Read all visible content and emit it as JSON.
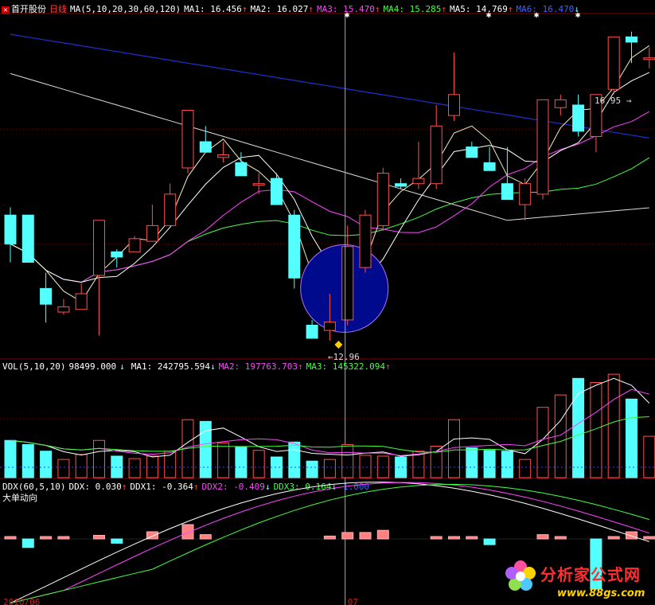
{
  "stock": {
    "name": "首开股份",
    "period": "日线"
  },
  "price_panel": {
    "indicator": "MA(5,10,20,30,60,120)",
    "items": [
      {
        "label": "MA1:",
        "value": "16.456",
        "arrow": "↑",
        "color": "#ffffff"
      },
      {
        "label": "MA2:",
        "value": "16.027",
        "arrow": "↑",
        "color": "#ffffff"
      },
      {
        "label": "MA3:",
        "value": "15.470",
        "arrow": "↑",
        "color": "#ff44ff"
      },
      {
        "label": "MA4:",
        "value": "15.285",
        "arrow": "↑",
        "color": "#44ff44"
      },
      {
        "label": "MA5:",
        "value": "14.769",
        "arrow": "↑",
        "color": "#ffffff"
      },
      {
        "label": "MA6:",
        "value": "16.470",
        "arrow": "↓",
        "color": "#4060ff"
      }
    ],
    "high_label": "16.95",
    "low_label": "12.96"
  },
  "vol_panel": {
    "indicator": "VOL(5,10,20)",
    "value": "98499.000",
    "arrow": "↓",
    "items": [
      {
        "label": "MA1:",
        "value": "242795.594",
        "arrow": "↓",
        "color": "#ffffff"
      },
      {
        "label": "MA2:",
        "value": "197763.703",
        "arrow": "↑",
        "color": "#ff44ff"
      },
      {
        "label": "MA3:",
        "value": "145322.094",
        "arrow": "↑",
        "color": "#44ff44"
      }
    ]
  },
  "ddx_panel": {
    "indicator": "DDX(60,5,10)",
    "items": [
      {
        "label": "DDX:",
        "value": "0.030",
        "arrow": "↑",
        "color": "#ffffff"
      },
      {
        "label": "DDX1:",
        "value": "-0.364",
        "arrow": "↑",
        "color": "#ffffff"
      },
      {
        "label": "DDX2:",
        "value": "-0.409",
        "arrow": "↓",
        "color": "#ff44ff"
      },
      {
        "label": "DDX3:",
        "value": "0.164",
        "arrow": "↓",
        "color": "#44ff44"
      }
    ],
    "ref_value": "1.000",
    "subtitle": "大单动向"
  },
  "watermark": {
    "brand": "分析家公式网",
    "url": "www.88gs.com"
  },
  "colors": {
    "up": "#ff5050",
    "down": "#54ffff",
    "grid": "#800000",
    "ma6": "#2030d0"
  },
  "chart_data": {
    "type": "candlestick",
    "candles": [
      {
        "o": 15.0,
        "h": 15.15,
        "l": 14.1,
        "c": 14.45
      },
      {
        "o": 15.0,
        "h": 15.0,
        "l": 14.2,
        "c": 14.1
      },
      {
        "o": 13.6,
        "h": 13.9,
        "l": 12.95,
        "c": 13.3
      },
      {
        "o": 13.15,
        "h": 13.4,
        "l": 13.1,
        "c": 13.25
      },
      {
        "o": 13.2,
        "h": 13.7,
        "l": 13.2,
        "c": 13.5
      },
      {
        "o": 13.85,
        "h": 14.8,
        "l": 12.7,
        "c": 14.9
      },
      {
        "o": 14.3,
        "h": 14.35,
        "l": 14.0,
        "c": 14.2
      },
      {
        "o": 14.3,
        "h": 14.6,
        "l": 14.3,
        "c": 14.55
      },
      {
        "o": 14.5,
        "h": 15.2,
        "l": 14.5,
        "c": 14.8
      },
      {
        "o": 14.8,
        "h": 15.6,
        "l": 14.8,
        "c": 15.4
      },
      {
        "o": 15.9,
        "h": 16.5,
        "l": 15.8,
        "c": 17.0
      },
      {
        "o": 16.4,
        "h": 16.7,
        "l": 16.3,
        "c": 16.2
      },
      {
        "o": 16.1,
        "h": 16.4,
        "l": 16.0,
        "c": 16.15
      },
      {
        "o": 16.0,
        "h": 16.2,
        "l": 15.8,
        "c": 15.75
      },
      {
        "o": 15.6,
        "h": 15.8,
        "l": 15.4,
        "c": 15.6
      },
      {
        "o": 15.7,
        "h": 15.8,
        "l": 15.2,
        "c": 15.2
      },
      {
        "o": 15.0,
        "h": 15.1,
        "l": 13.6,
        "c": 13.8
      },
      {
        "o": 12.9,
        "h": 13.0,
        "l": 12.7,
        "c": 12.65
      },
      {
        "o": 12.8,
        "h": 13.5,
        "l": 12.6,
        "c": 12.96
      },
      {
        "o": 13.0,
        "h": 14.8,
        "l": 12.9,
        "c": 14.4
      },
      {
        "o": 14.0,
        "h": 15.1,
        "l": 13.9,
        "c": 15.0
      },
      {
        "o": 14.8,
        "h": 15.9,
        "l": 14.7,
        "c": 15.8
      },
      {
        "o": 15.6,
        "h": 15.7,
        "l": 15.5,
        "c": 15.55
      },
      {
        "o": 15.6,
        "h": 16.4,
        "l": 15.5,
        "c": 15.7
      },
      {
        "o": 15.6,
        "h": 17.1,
        "l": 15.5,
        "c": 16.7
      },
      {
        "o": 16.9,
        "h": 18.1,
        "l": 16.8,
        "c": 17.3
      },
      {
        "o": 16.3,
        "h": 16.4,
        "l": 16.1,
        "c": 16.1
      },
      {
        "o": 16.0,
        "h": 16.3,
        "l": 15.9,
        "c": 15.85
      },
      {
        "o": 15.6,
        "h": 16.3,
        "l": 15.4,
        "c": 15.3
      },
      {
        "o": 15.2,
        "h": 15.7,
        "l": 14.9,
        "c": 15.6
      },
      {
        "o": 15.4,
        "h": 17.2,
        "l": 15.3,
        "c": 17.2
      },
      {
        "o": 17.05,
        "h": 17.3,
        "l": 16.9,
        "c": 17.2
      },
      {
        "o": 17.1,
        "h": 17.3,
        "l": 16.5,
        "c": 16.6
      },
      {
        "o": 16.5,
        "h": 17.0,
        "l": 16.2,
        "c": 17.3
      },
      {
        "o": 17.4,
        "h": 18.4,
        "l": 17.3,
        "c": 18.4
      },
      {
        "o": 18.4,
        "h": 18.5,
        "l": 17.9,
        "c": 18.3
      },
      {
        "o": 18.0,
        "h": 18.2,
        "l": 17.8,
        "c": 18.0
      }
    ],
    "volume": [
      45,
      40,
      32,
      22,
      28,
      45,
      26,
      23,
      26,
      32,
      70,
      68,
      42,
      37,
      33,
      25,
      43,
      20,
      22,
      40,
      27,
      26,
      25,
      32,
      38,
      70,
      36,
      33,
      32,
      22,
      85,
      100,
      120,
      115,
      125,
      95,
      50
    ],
    "ddx": [
      0.03,
      -0.12,
      0.02,
      0.01,
      0.0,
      0.05,
      -0.06,
      0.0,
      0.1,
      0.0,
      0.2,
      0.06,
      0.0,
      0.0,
      0.0,
      0.0,
      0.0,
      0.0,
      0.04,
      0.09,
      0.09,
      0.12,
      0.0,
      0.0,
      0.02,
      0.03,
      0.02,
      -0.08,
      0.0,
      0.0,
      0.06,
      0.03,
      0.0,
      -0.7,
      0.03,
      0.1,
      0.03
    ],
    "ddx_ref": 1.0,
    "xlabels": [
      "2010/06",
      "07"
    ]
  }
}
